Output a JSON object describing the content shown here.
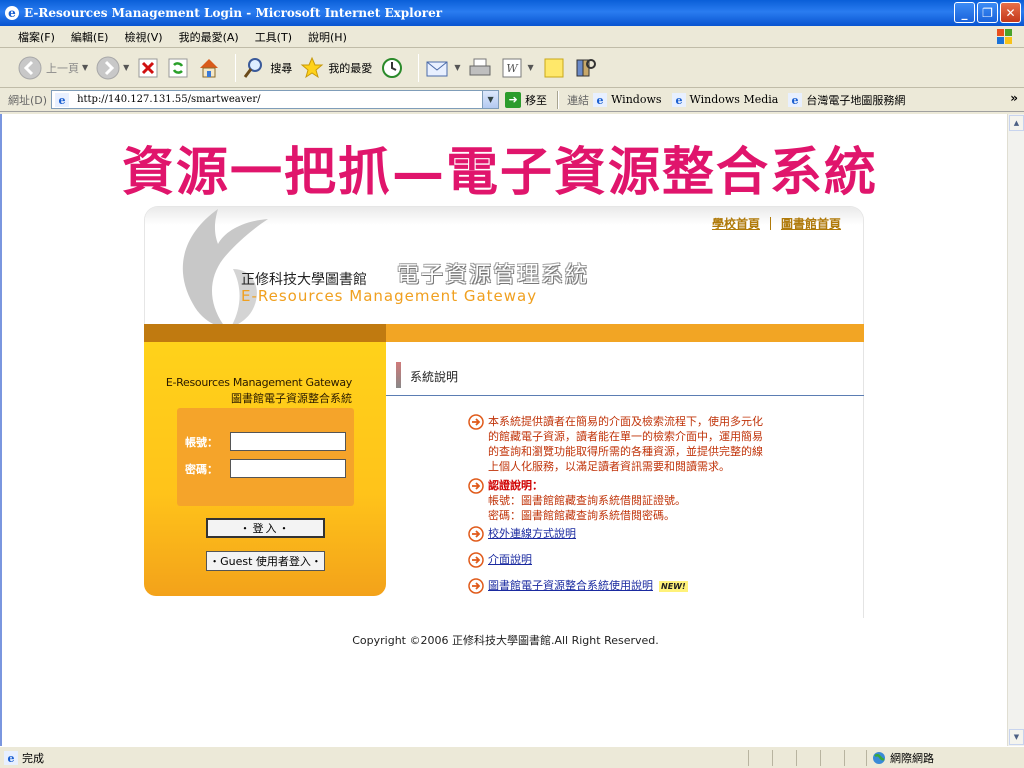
{
  "window": {
    "title": "E-Resources Management Login - Microsoft Internet Explorer"
  },
  "menu": [
    "檔案(F)",
    "編輯(E)",
    "檢視(V)",
    "我的最愛(A)",
    "工具(T)",
    "說明(H)"
  ],
  "toolbar": {
    "back": "上一頁",
    "search": "搜尋",
    "favorites": "我的最愛"
  },
  "address": {
    "label": "網址(D)",
    "url": "http://140.127.131.55/smartweaver/",
    "go": "移至"
  },
  "links": {
    "label": "連結",
    "items": [
      "Windows",
      "Windows Media",
      "台灣電子地圖服務網"
    ]
  },
  "page": {
    "banner": "資源一把抓—電子資源整合系統",
    "top_links": [
      "學校首頁",
      "圖書館首頁"
    ],
    "lib_name": "正修科技大學圖書館",
    "sys_name": "電子資源管理系統",
    "en_name": "E-Resources Management Gateway",
    "login": {
      "line1": "E-Resources Management Gateway",
      "line2": "圖書館電子資源整合系統",
      "account_label": "帳號：",
      "password_label": "密碼：",
      "login_button": "・登入・",
      "guest_button": "・Guest 使用者登入・"
    },
    "info": {
      "heading": "系統說明",
      "intro": [
        "本系統提供讀者在簡易的介面及檢索流程下，使用多元化",
        "的館藏電子資源，讀者能在單一的檢索介面中，運用簡易",
        "的查詢和瀏覽功能取得所需的各種資源，並提供完整的線",
        "上個人化服務，以滿足讀者資訊需要和閱讀需求。"
      ],
      "auth_title": "認證說明：",
      "auth_lines": [
        "帳號：圖書館館藏查詢系統借閱証證號。",
        "密碼：圖書館館藏查詢系統借閱密碼。"
      ],
      "link1": "校外連線方式說明",
      "link2": "介面說明",
      "link3": "圖書館電子資源整合系統使用說明",
      "new_badge": "NEW!"
    },
    "copyright": "Copyright ©2006 正修科技大學圖書館.All Right Reserved."
  },
  "status": {
    "text": "完成",
    "zone": "網際網路"
  }
}
